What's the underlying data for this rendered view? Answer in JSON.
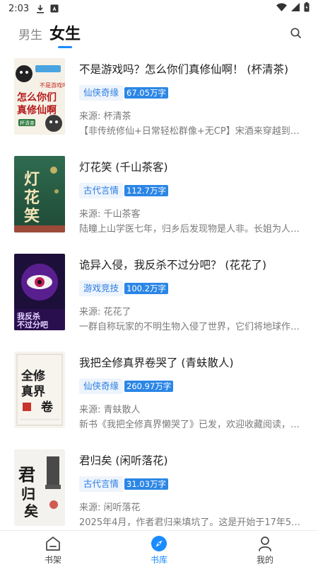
{
  "status": {
    "time": "2:03"
  },
  "tabs": {
    "male": "男生",
    "female": "女生"
  },
  "books": [
    {
      "title": "不是游戏吗？怎么你们真修仙啊！ (杯清茶)",
      "category": "仙侠奇缘",
      "words": "67.05万字",
      "source": "来源: 杯清茶",
      "desc": "【非传统修仙+日常轻松群像+无CP】宋酒来穿越到修…",
      "cover_text_top": "不是游戏吗？",
      "cover_text_main": "怎么你们真修仙啊",
      "cover_author": "杯清茶"
    },
    {
      "title": "灯花笑 (千山茶客)",
      "category": "古代言情",
      "words": "112.7万字",
      "source": "来源: 千山茶客",
      "desc": "陆瞳上山学医七年，归乡后发现物是人非。长姐为人…",
      "cover_text_main": "灯花笑"
    },
    {
      "title": "诡异入侵，我反杀不过分吧？ (花花了)",
      "category": "游戏竞技",
      "words": "100.2万字",
      "source": "来源: 花花了",
      "desc": "一群自称玩家的不明生物入侵了世界，它们将地球作…",
      "cover_text_main": "我反杀不过分吧"
    },
    {
      "title": "我把全修真界卷哭了 (青蚨散人)",
      "category": "仙侠奇缘",
      "words": "260.97万字",
      "source": "来源: 青蚨散人",
      "desc": "新书《我把全修真界懒哭了》已发，欢迎收藏阅读，…",
      "cover_text_main": "全修真界卷哭了"
    },
    {
      "title": "君归矣 (闲听落花)",
      "category": "古代言情",
      "words": "31.03万字",
      "source": "来源: 闲听落花",
      "desc": "2025年4月，作者君归来填坑了。这是开始于17年5月…",
      "cover_text_main": "君归矣"
    }
  ],
  "nav": [
    {
      "label": "书架",
      "icon": "bookshelf-icon"
    },
    {
      "label": "书库",
      "icon": "compass-icon"
    },
    {
      "label": "我的",
      "icon": "person-icon"
    }
  ],
  "colors": {
    "accent": "#1a8cff",
    "tag_bg": "#eef4fc",
    "words_bg": "#2b86e6"
  }
}
